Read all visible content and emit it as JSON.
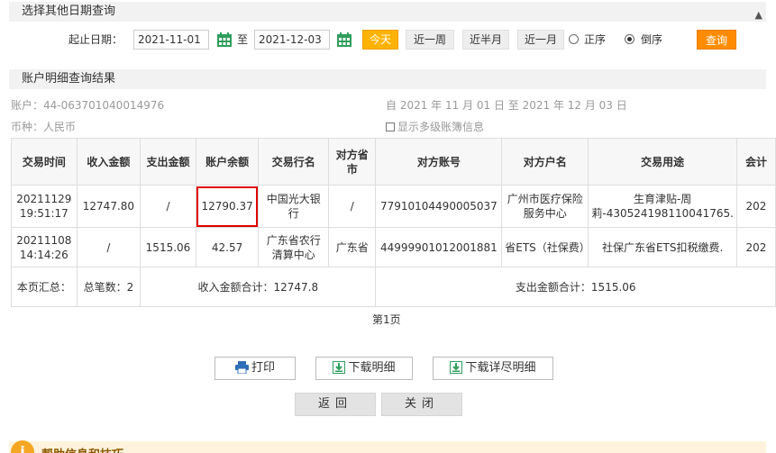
{
  "query_section": {
    "title": "选择其他日期查询",
    "date_label": "起止日期：",
    "start_date": "2021-11-01",
    "to_label": "至",
    "end_date": "2021-12-03",
    "today_label": "今天",
    "week_label": "近一周",
    "halfmonth_label": "近半月",
    "month_label": "近一月",
    "asc_label": "正序",
    "desc_label": "倒序",
    "search_label": "查询"
  },
  "result_section": {
    "title": "账户明细查询结果",
    "account": "账户：44-063701040014976",
    "currency": "币种：人民币",
    "date_range": "自 2021 年 11 月 01 日 至 2021 年 12 月 03 日",
    "multi_level_label": "显示多级账簿信息"
  },
  "table": {
    "headers": [
      "交易时间",
      "收入金额",
      "支出金额",
      "账户余额",
      "交易行名",
      "对方省市",
      "对方账号",
      "对方户名",
      "交易用途",
      "会计"
    ],
    "rows": [
      {
        "time": "20211129 19:51:17",
        "income": "12747.80",
        "expense": "/",
        "balance": "12790.37",
        "bank": "中国光大银行",
        "province": "/",
        "account": "77910104490005037",
        "name": "广州市医疗保险服务中心",
        "purpose": "生育津贴-周莉-430524198110041765.",
        "acc": "202"
      },
      {
        "time": "20211108 14:14:26",
        "income": "/",
        "expense": "1515.06",
        "balance": "42.57",
        "bank": "广东省农行清算中心",
        "province": "广东省",
        "account": "44999901012001881",
        "name": "省ETS（社保费）",
        "purpose": "社保广东省ETS扣税缴费.",
        "acc": "202"
      }
    ],
    "summary": {
      "label": "本页汇总：",
      "count": "总笔数：2",
      "income_total": "收入金额合计：12747.8",
      "expense_total": "支出金额合计：1515.06"
    }
  },
  "pagination": {
    "page": "第1页"
  },
  "actions": {
    "print": "打印",
    "download": "下载明细",
    "download_full": "下载详尽明细",
    "back": "返回",
    "close": "关闭"
  },
  "help": {
    "title": "帮助信息和技巧"
  },
  "colors": {
    "today": "#ffb300",
    "search": "#ff8c00",
    "highlight": "#e00000",
    "calendar": "#2f9e5c"
  }
}
